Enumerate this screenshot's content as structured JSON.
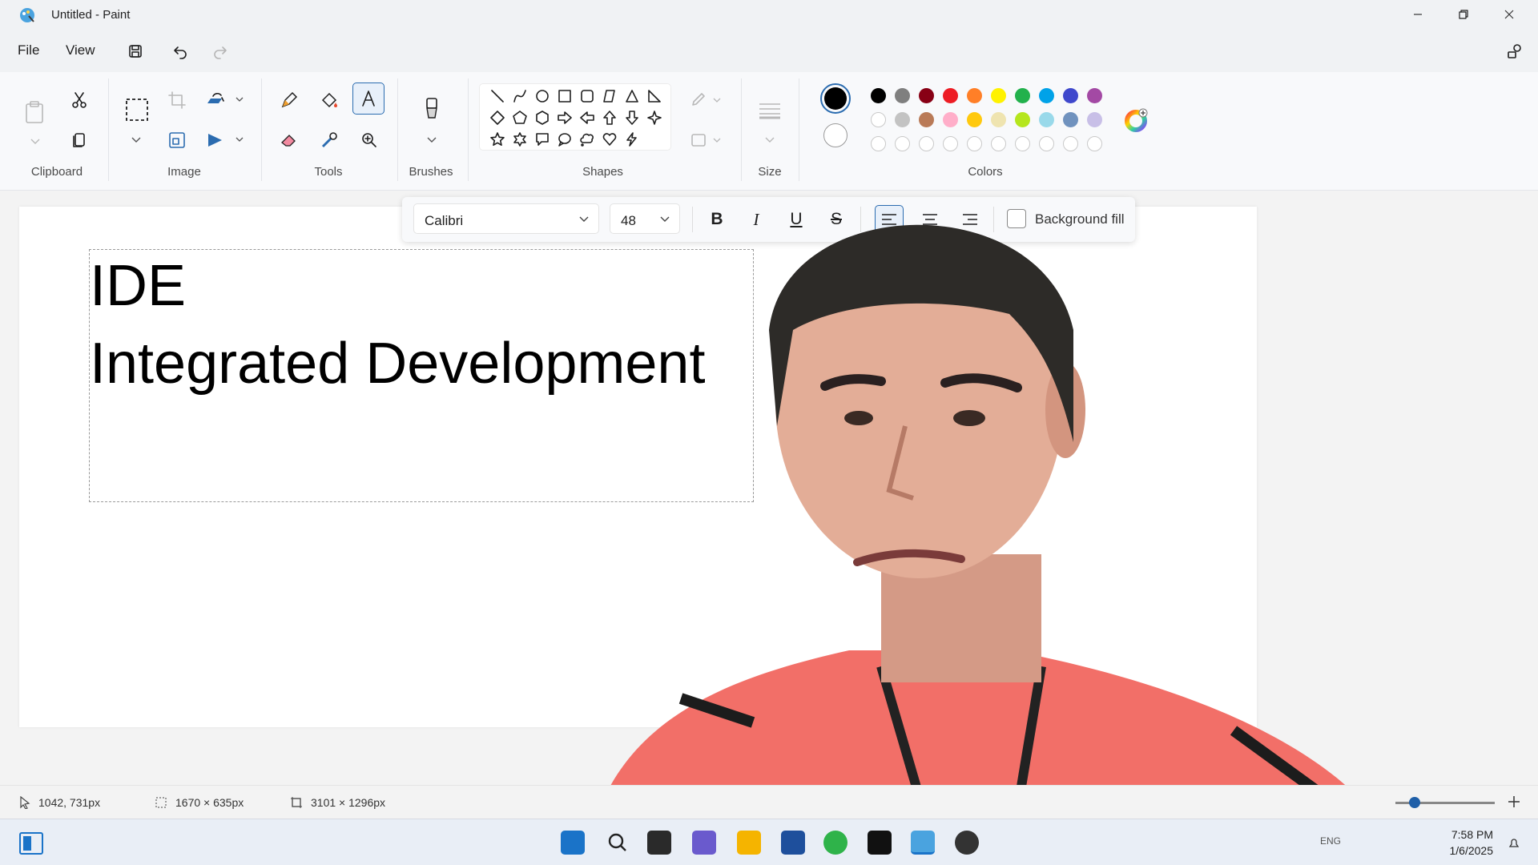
{
  "window": {
    "title": "Untitled - Paint"
  },
  "menu": {
    "file": "File",
    "view": "View"
  },
  "ribbon": {
    "groups": {
      "clipboard": "Clipboard",
      "image": "Image",
      "tools": "Tools",
      "brushes": "Brushes",
      "shapes": "Shapes",
      "size": "Size",
      "colors": "Colors"
    },
    "active_tool": "text-tool",
    "primary_color": "#000000",
    "secondary_color": "#ffffff",
    "palette_row1": [
      "#000000",
      "#7f7f7f",
      "#880015",
      "#ed1c24",
      "#ff7f27",
      "#fff200",
      "#22b14c",
      "#00a2e8",
      "#3f48cc",
      "#a349a4"
    ],
    "palette_row2": [
      "#ffffff",
      "#c3c3c3",
      "#b97a57",
      "#ffaec9",
      "#ffc90e",
      "#efe4b0",
      "#b5e61d",
      "#99d9ea",
      "#7092be",
      "#c8bfe7"
    ]
  },
  "text_toolbar": {
    "font": "Calibri",
    "size": "48",
    "bold": "B",
    "italic": "I",
    "underline": "U",
    "strike": "S",
    "background_fill": "Background fill"
  },
  "canvas": {
    "line1": "IDE",
    "line2": "Integrated Development"
  },
  "status": {
    "cursor": "1042, 731px",
    "selection": "1670 × 635px",
    "canvas_size": "3101 × 1296px"
  },
  "clock": {
    "time": "7:58 PM",
    "date": "1/6/2025"
  },
  "tray": {
    "lang": "ENG"
  }
}
